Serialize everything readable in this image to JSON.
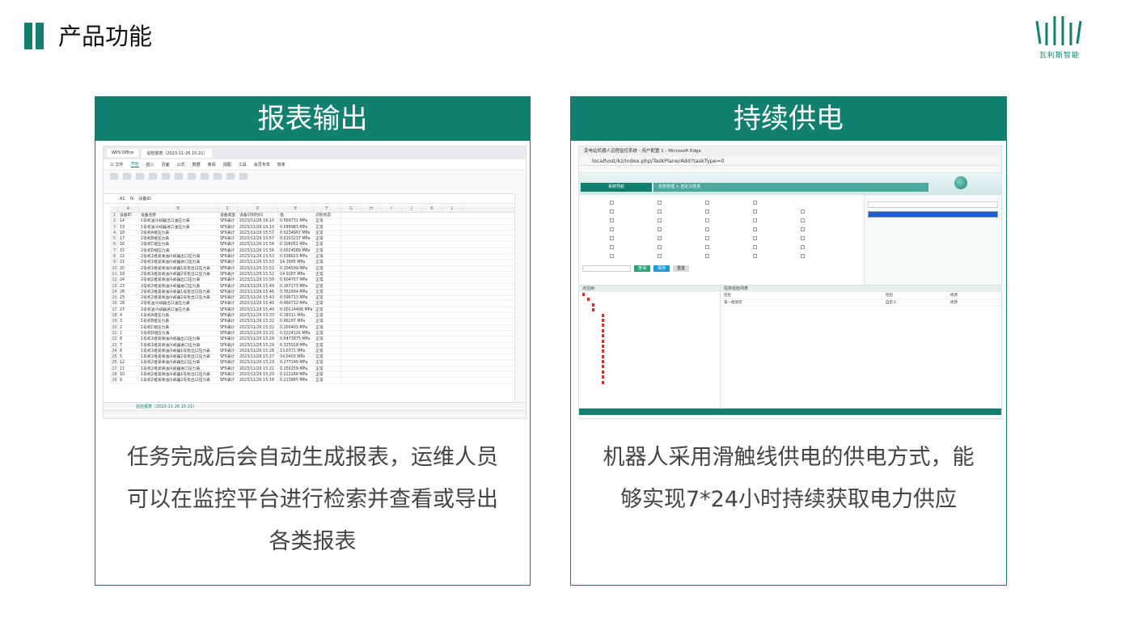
{
  "page": {
    "title": "产品功能",
    "brand_name": "瓦利斯智能",
    "accent_color": "#12806e"
  },
  "cards": [
    {
      "title": "报表输出",
      "desc_lines": [
        "任务完成后会自动生成报表，运维人员",
        "可以在监控平台进行检索并查看或导出",
        "各类报表"
      ]
    },
    {
      "title": "持续供电",
      "desc_lines": [
        "机器人采用滑触线供电的供电方式，能",
        "够实现7*24小时持续获取电力供应"
      ]
    }
  ],
  "wps": {
    "app_tab": "WPS Office",
    "file_tab": "巡检报表（2023-11-26 15:21）",
    "menu": [
      "三 文件",
      "开始",
      "插入",
      "页面",
      "公式",
      "数据",
      "审阅",
      "视图",
      "工具",
      "会员专享",
      "效率"
    ],
    "active_menu": "开始",
    "cell_ref": "A1",
    "formula": "设备ID",
    "columns": [
      "A",
      "B",
      "C",
      "D",
      "E",
      "F",
      "G",
      "H",
      "I",
      "J",
      "K",
      "L",
      "M",
      "N",
      "O"
    ],
    "header_row": [
      "设备ID",
      "设备名称",
      "设备类型",
      "设备识别时间",
      "值",
      "识别状态"
    ],
    "rows": [
      [
        "14",
        "1号机油冷却器出口油压力表",
        "SF6表计",
        "2023/11/26 16:10",
        "0.569731 MPa",
        "正常"
      ],
      [
        "13",
        "1号机油冷却器进口油压力表",
        "SF6表计",
        "2023/11/26 16:10",
        "0.099983 MPa",
        "正常"
      ],
      [
        "18",
        "2号机A组压力表",
        "SF6表计",
        "2023/11/26 15:57",
        "0.0234967 MPa",
        "正常"
      ],
      [
        "17",
        "2号机B组压力表",
        "SF6表计",
        "2023/11/26 15:57",
        "0.0103237 MPa",
        "正常"
      ],
      [
        "16",
        "2号机C组压力表",
        "SF6表计",
        "2023/11/26 15:56",
        "0.106051 MPa",
        "正常"
      ],
      [
        "15",
        "2号机D组压力表",
        "SF6表计",
        "2023/11/26 15:56",
        "0.0024589 MPa",
        "正常"
      ],
      [
        "22",
        "2号机1组润滑油冷却器出口压力表",
        "SF6表计",
        "2023/11/26 15:53",
        "0.038023 MPa",
        "正常"
      ],
      [
        "21",
        "2号机1组润滑油冷却器进口压力表",
        "SF6表计",
        "2023/11/26 15:53",
        "14.3995 MPa",
        "正常"
      ],
      [
        "20",
        "2号机1组润滑油冷却器1号泵出口压力表",
        "SF6表计",
        "2023/11/26 15:52",
        "0.104599 MPa",
        "正常"
      ],
      [
        "19",
        "2号机1组润滑油冷却器2号泵出口压力表",
        "SF6表计",
        "2023/11/26 15:52",
        "14.0287 MPa",
        "正常"
      ],
      [
        "24",
        "2号机2组润滑油冷却器出口压力表",
        "SF6表计",
        "2023/11/26 15:50",
        "0.604757 MPa",
        "正常"
      ],
      [
        "23",
        "2号机2组润滑油冷却器进口压力表",
        "SF6表计",
        "2023/11/26 15:49",
        "0.167173 MPa",
        "正常"
      ],
      [
        "26",
        "2号机2组润滑油冷却器1号泵出口压力表",
        "SF6表计",
        "2023/11/26 15:46",
        "0.762694 MPa",
        "正常"
      ],
      [
        "25",
        "2号机2组润滑油冷却器2号泵出口压力表",
        "SF6表计",
        "2023/11/26 15:43",
        "0.596713 MPa",
        "正常"
      ],
      [
        "28",
        "2号机油冷却器出口油压力表",
        "SF6表计",
        "2023/11/26 15:40",
        "0.460712 MPa",
        "正常"
      ],
      [
        "27",
        "2号机油冷却器进口油压力表",
        "SF6表计",
        "2023/11/26 15:40",
        "0.00114496 MPa",
        "正常"
      ],
      [
        "4",
        "1号机A组压力表",
        "SF6表计",
        "2023/11/26 15:33",
        "0.18311 MPa",
        "正常"
      ],
      [
        "3",
        "1号机B组压力表",
        "SF6表计",
        "2023/11/26 15:32",
        "0.66297 MPa",
        "正常"
      ],
      [
        "2",
        "1号机C组压力表",
        "SF6表计",
        "2023/11/26 15:32",
        "0.200403 MPa",
        "正常"
      ],
      [
        "1",
        "1号机D组压力表",
        "SF6表计",
        "2023/11/26 15:31",
        "0.0224191 MPa",
        "正常"
      ],
      [
        "8",
        "1号机1组润滑油冷却器出口压力表",
        "SF6表计",
        "2023/11/26 15:29",
        "0.0473975 MPa",
        "正常"
      ],
      [
        "7",
        "1号机1组润滑油冷却器进口压力表",
        "SF6表计",
        "2023/11/26 15:29",
        "0.325018 MPa",
        "正常"
      ],
      [
        "6",
        "1号机1组润滑油冷却器1号泵出口压力表",
        "SF6表计",
        "2023/11/26 15:28",
        "13.0371 MPa",
        "正常"
      ],
      [
        "5",
        "1号机1组润滑油冷却器2号泵出口压力表",
        "SF6表计",
        "2023/11/26 15:27",
        "14.0403 MPa",
        "正常"
      ],
      [
        "12",
        "1号机2组润滑油冷却器出口压力表",
        "SF6表计",
        "2023/11/26 15:23",
        "0.277146 MPa",
        "正常"
      ],
      [
        "11",
        "1号机2组润滑油冷却器进口压力表",
        "SF6表计",
        "2023/11/26 15:22",
        "0.250259 MPa",
        "正常"
      ],
      [
        "10",
        "1号机2组润滑油冷却器1号泵出口压力表",
        "SF6表计",
        "2023/11/26 15:20",
        "0.222266 MPa",
        "正常"
      ],
      [
        "9",
        "1号机2组润滑油冷却器2号泵出口压力表",
        "SF6表计",
        "2023/11/26 15:18",
        "0.213865 MPa",
        "正常"
      ]
    ],
    "sheet_tab": "巡检报表（2023-11-26 15-21）",
    "zoom": "100%"
  },
  "edge": {
    "window_title": "变电站机器人远程监控系统 - 用户配置 1 - Microsoft Edge",
    "url": "localhost/kz/index.php/TaskPlane/Add?taskType=0",
    "nav_label": "系统导航",
    "breadcrumb": "任务管理 > 自定义任务",
    "search_btn": "查询",
    "save_btn": "保存",
    "reset_btn": "重置",
    "tree_header": "点位树",
    "list_header": "任务巡检列表",
    "list_rows": [
      [
        "巡检",
        "巡检",
        "修改"
      ],
      [
        "第一组巡检",
        "自定义",
        "修改"
      ]
    ]
  }
}
